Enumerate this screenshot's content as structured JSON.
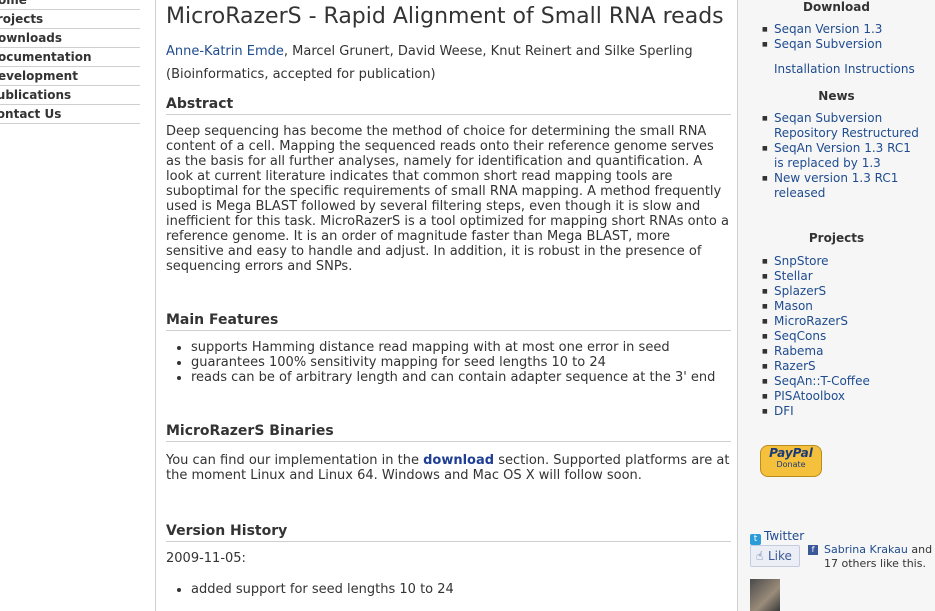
{
  "nav": {
    "items": [
      "Home",
      "Projects",
      "Downloads",
      "Documentation",
      "Development",
      "Publications",
      "Contact Us"
    ]
  },
  "main": {
    "title": "MicroRazerS - Rapid Alignment of Small RNA reads",
    "author_link": "Anne-Katrin Emde",
    "authors_rest": ", Marcel Grunert, David Weese, Knut Reinert and Silke Sperling",
    "publication": "(Bioinformatics, accepted for publication)",
    "abstract_heading": "Abstract",
    "abstract_text": "Deep sequencing has become the method of choice for determining the small RNA content of a cell. Mapping the sequenced reads onto their reference genome serves as the basis for all further analyses, namely for identification and quantification. A look at current literature indicates that common short read mapping tools are suboptimal for the specific requirements of small RNA mapping. A method frequently used is Mega BLAST followed by several filtering steps, even though it is slow and inefficient for this task. MicroRazerS is a tool optimized for mapping short RNAs onto a reference genome. It is an order of magnitude faster than Mega BLAST, more sensitive and easy to handle and adjust. In addition, it is robust in the presence of sequencing errors and SNPs.",
    "features_heading": "Main Features",
    "features": [
      "supports Hamming distance read mapping with at most one error in seed",
      "guarantees 100% sensitivity mapping for seed lengths 10 to 24",
      "reads can be of arbitrary length and can contain adapter sequence at the 3' end"
    ],
    "binaries_heading": "MicroRazerS Binaries",
    "binaries_pre": "You can find our implementation in the ",
    "binaries_link": "download",
    "binaries_post": " section. Supported platforms are at the moment Linux and Linux 64. Windows and Mac OS X will follow soon.",
    "history_heading": "Version History",
    "history_date": "2009-11-05:",
    "history_item": "added support for seed lengths 10 to 24"
  },
  "right": {
    "download_heading": "Download",
    "download_links": [
      "Seqan Version 1.3",
      "Seqan Subversion"
    ],
    "install_link": "Installation Instructions",
    "news_heading": "News",
    "news_links": [
      "Seqan Subversion Repository Restructured",
      "SeqAn Version 1.3 RC1 is replaced by 1.3",
      "New version 1.3 RC1 released"
    ],
    "projects_heading": "Projects",
    "projects": [
      "SnpStore",
      "Stellar",
      "SplazerS",
      "Mason",
      "MicroRazerS",
      "SeqCons",
      "Rabema",
      "RazerS",
      "SeqAn::T-Coffee",
      "PISAtoolbox",
      "DFI"
    ],
    "paypal_logo": "PayPal",
    "paypal_label": "Donate",
    "twitter_label": "Twitter",
    "like_label": "Like",
    "fb_name": "Sabrina Krakau",
    "fb_text": " and 17 others like this."
  }
}
